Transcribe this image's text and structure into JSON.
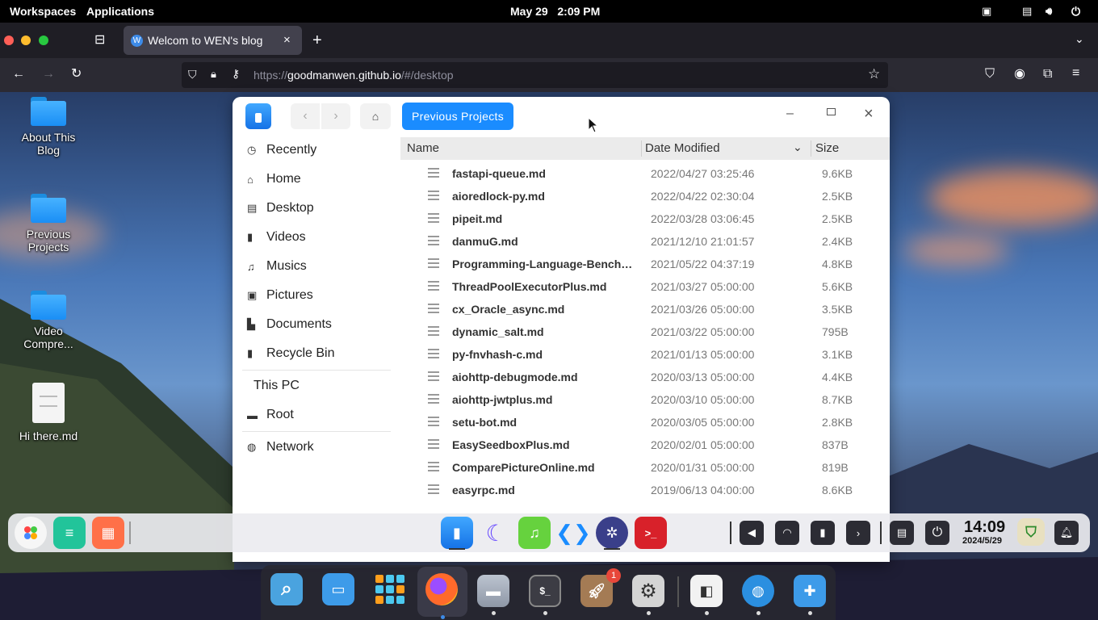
{
  "topbar": {
    "workspaces": "Workspaces",
    "applications": "Applications",
    "datetime": "May 29   2:09 PM"
  },
  "browser": {
    "tab_title": "Welcom to WEN's blog",
    "tab_favicon": "W",
    "url_prefix": "https://",
    "url_host": "goodmanwen.github.io",
    "url_path": "/#/desktop"
  },
  "desktop_icons": [
    {
      "label": "About This Blog",
      "icon": "folder-icon"
    },
    {
      "label": "Previous Projects",
      "icon": "folder-icon"
    },
    {
      "label": "Video Compre...",
      "icon": "folder-icon"
    },
    {
      "label": "Hi there.md",
      "icon": "document-icon"
    }
  ],
  "file_manager": {
    "breadcrumb": "Previous Projects",
    "sidebar": [
      {
        "label": "Recently",
        "icon": "clock-icon"
      },
      {
        "label": "Home",
        "icon": "home-icon"
      },
      {
        "label": "Desktop",
        "icon": "desktop-icon"
      },
      {
        "label": "Videos",
        "icon": "video-icon"
      },
      {
        "label": "Musics",
        "icon": "music-icon"
      },
      {
        "label": "Pictures",
        "icon": "picture-icon"
      },
      {
        "label": "Documents",
        "icon": "document-icon"
      },
      {
        "label": "Recycle Bin",
        "icon": "trash-icon"
      }
    ],
    "this_pc": "This PC",
    "root": "Root",
    "network": "Network",
    "columns": {
      "name": "Name",
      "date": "Date Modified",
      "size": "Size"
    },
    "files": [
      {
        "name": "fastapi-queue.md",
        "date": "2022/04/27 03:25:46",
        "size": "9.6KB"
      },
      {
        "name": "aioredlock-py.md",
        "date": "2022/04/22 02:30:04",
        "size": "2.5KB"
      },
      {
        "name": "pipeit.md",
        "date": "2022/03/28 03:06:45",
        "size": "2.5KB"
      },
      {
        "name": "danmuG.md",
        "date": "2021/12/10 21:01:57",
        "size": "2.4KB"
      },
      {
        "name": "Programming-Language-Benchm...",
        "date": "2021/05/22 04:37:19",
        "size": "4.8KB"
      },
      {
        "name": "ThreadPoolExecutorPlus.md",
        "date": "2021/03/27 05:00:00",
        "size": "5.6KB"
      },
      {
        "name": "cx_Oracle_async.md",
        "date": "2021/03/26 05:00:00",
        "size": "3.5KB"
      },
      {
        "name": "dynamic_salt.md",
        "date": "2021/03/22 05:00:00",
        "size": "795B"
      },
      {
        "name": "py-fnvhash-c.md",
        "date": "2021/01/13 05:00:00",
        "size": "3.1KB"
      },
      {
        "name": "aiohttp-debugmode.md",
        "date": "2020/03/13 05:00:00",
        "size": "4.4KB"
      },
      {
        "name": "aiohttp-jwtplus.md",
        "date": "2020/03/10 05:00:00",
        "size": "8.7KB"
      },
      {
        "name": "setu-bot.md",
        "date": "2020/03/05 05:00:00",
        "size": "2.8KB"
      },
      {
        "name": "EasySeedboxPlus.md",
        "date": "2020/02/01 05:00:00",
        "size": "837B"
      },
      {
        "name": "ComparePictureOnline.md",
        "date": "2020/01/31 05:00:00",
        "size": "819B"
      },
      {
        "name": "easyrpc.md",
        "date": "2019/06/13 04:00:00",
        "size": "8.6KB"
      }
    ]
  },
  "taskbar": {
    "clock_time": "14:09",
    "clock_date": "2024/5/29"
  },
  "dock": {
    "badge_count": "1"
  },
  "colors": {
    "accent": "#1a8cff",
    "topbar": "#000000",
    "browser_bg": "#2b2a33"
  }
}
